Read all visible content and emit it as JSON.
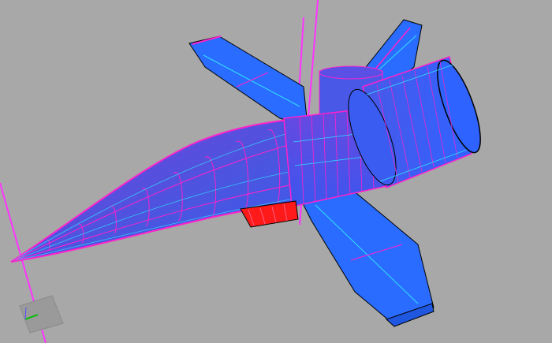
{
  "viewport": {
    "background": "#a8a8a8"
  },
  "model": {
    "surface_color": "#2a6cff",
    "wire_color": "#ff22cc",
    "accent_wire_color": "#33e0ff",
    "edge_color": "#000000",
    "exhaust_color": "#ff1a1a",
    "axis_color": "#ff33ff"
  },
  "view_cube": {
    "face_color": "#9a9a9a",
    "edge_color": "#8a8a8a",
    "axis_x_color": "#00c000",
    "axis_y_color": "#5050ff"
  }
}
